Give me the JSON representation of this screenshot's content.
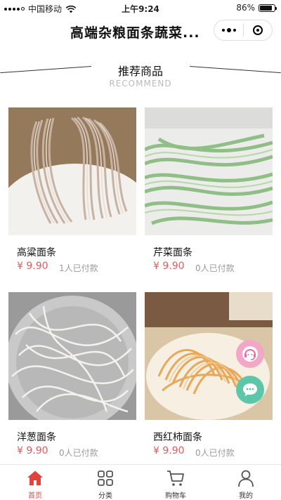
{
  "status_bar": {
    "carrier": "中国移动",
    "time": "上午9:24",
    "battery": "86%",
    "battery_level": 0.86
  },
  "nav": {
    "title": "高端杂粮面条蔬菜..."
  },
  "section": {
    "title": "推荐商品",
    "subtitle": "RECOMMEND"
  },
  "products": [
    {
      "name": "高粱面条",
      "price": "¥ 9.90",
      "sold": "1人已付款"
    },
    {
      "name": "芹菜面条",
      "price": "¥ 9.90",
      "sold": "0人已付款"
    },
    {
      "name": "洋葱面条",
      "price": "¥ 9.90",
      "sold": "0人已付款"
    },
    {
      "name": "西红柿面条",
      "price": "¥ 9.90",
      "sold": "0人已付款"
    }
  ],
  "tabs": [
    {
      "label": "首页",
      "icon": "home-icon"
    },
    {
      "label": "分类",
      "icon": "category-icon"
    },
    {
      "label": "购物车",
      "icon": "cart-icon"
    },
    {
      "label": "我的",
      "icon": "user-icon"
    }
  ],
  "colors": {
    "accent": "#e0443c",
    "price": "#e85b5b",
    "service": "#f2a7c6",
    "chat": "#5cc6a8"
  }
}
